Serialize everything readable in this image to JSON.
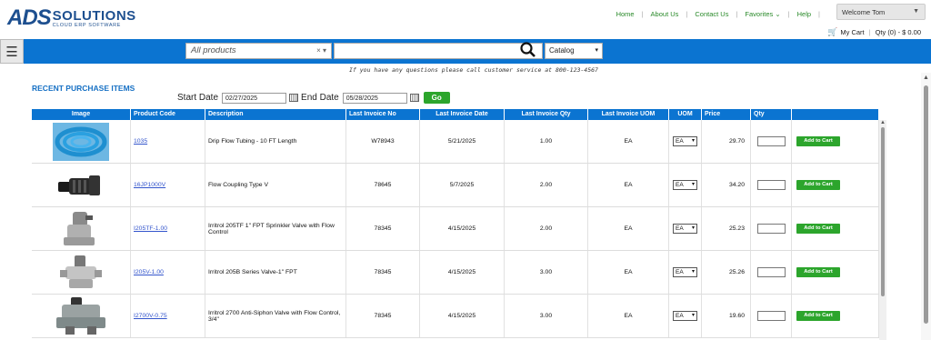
{
  "header": {
    "logo_mark": "ADS",
    "logo_text": "SOLUTIONS",
    "logo_tagline": "CLOUD ERP SOFTWARE",
    "links": [
      "Home",
      "About Us",
      "Contact Us",
      "Favorites",
      "Help"
    ],
    "welcome": "Welcome Tom",
    "cart_label": "My Cart",
    "cart_summary": "Qty (0) - $ 0.00"
  },
  "toolbar": {
    "products_placeholder": "All products",
    "search_value": "",
    "catalog_label": "Catalog"
  },
  "notice": "If you have any questions please call customer service at 800-123-4567",
  "recent": {
    "title": "RECENT PURCHASE ITEMS",
    "start_label": "Start Date",
    "start_value": "02/27/2025",
    "end_label": "End Date",
    "end_value": "05/28/2025",
    "go_label": "Go"
  },
  "table": {
    "headers": [
      "Image",
      "Product Code",
      "Description",
      "Last Invoice No",
      "Last Invoice Date",
      "Last Invoice Qty",
      "Last Invoice UOM",
      "UOM",
      "Price",
      "Qty",
      ""
    ],
    "add_label": "Add to Cart",
    "rows": [
      {
        "code": "1035",
        "description": "Drip Flow Tubing - 10 FT Length",
        "invoice_no": "W78943",
        "invoice_date": "5/21/2025",
        "invoice_qty": "1.00",
        "invoice_uom": "EA",
        "uom": "EA",
        "price": "29.70"
      },
      {
        "code": "16JP1000V",
        "description": "Flow Coupling Type V",
        "invoice_no": "78645",
        "invoice_date": "5/7/2025",
        "invoice_qty": "2.00",
        "invoice_uom": "EA",
        "uom": "EA",
        "price": "34.20"
      },
      {
        "code": "I205TF-1.00",
        "description": "Irritrol 205TF 1\" FPT Sprinkler Valve with Flow Control",
        "invoice_no": "78345",
        "invoice_date": "4/15/2025",
        "invoice_qty": "2.00",
        "invoice_uom": "EA",
        "uom": "EA",
        "price": "25.23"
      },
      {
        "code": "I205V-1.00",
        "description": "Irritrol 205B Series Valve-1\" FPT",
        "invoice_no": "78345",
        "invoice_date": "4/15/2025",
        "invoice_qty": "3.00",
        "invoice_uom": "EA",
        "uom": "EA",
        "price": "25.26"
      },
      {
        "code": "I2700V-0.75",
        "description": "Irritrol 2700 Anti-Siphon Valve with Flow Control, 3/4\"",
        "invoice_no": "78345",
        "invoice_date": "4/15/2025",
        "invoice_qty": "3.00",
        "invoice_uom": "EA",
        "uom": "EA",
        "price": "19.60"
      }
    ]
  },
  "colors": {
    "brand_blue": "#0b74d1",
    "accent_green": "#2ca52c",
    "link_blue": "#3355cc"
  }
}
